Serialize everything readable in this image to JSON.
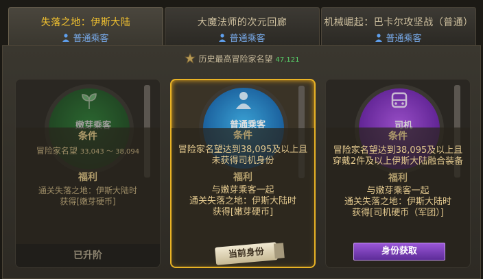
{
  "tabs": [
    {
      "title": "失落之地：伊斯大陆",
      "subtitle": "普通乘客"
    },
    {
      "title": "大魔法师的次元回廊",
      "subtitle": "普通乘客"
    },
    {
      "title": "机械崛起：巴卡尔攻坚战（普通）",
      "subtitle": "普通乘客"
    }
  ],
  "fame": {
    "label": "历史最高冒险家名望",
    "value": "47,121"
  },
  "cards": [
    {
      "emblem": "嫩芽乘客",
      "cond_title": "条件",
      "cond_line1": "冒险家名望",
      "cond_num": "33,043 ～ 38,094",
      "benefit_title": "福利",
      "benefit_line1": "通关失落之地：伊斯大陆时",
      "benefit_line2": "获得[嫩芽硬币]",
      "footer": "已升阶"
    },
    {
      "emblem": "普通乘客",
      "cond_title": "条件",
      "cond_line1": "冒险家名望达到38,095及以上且",
      "cond_line2": "未获得司机身份",
      "benefit_title": "福利",
      "benefit_line1": "与嫩芽乘客一起",
      "benefit_line2": "通关失落之地：伊斯大陆时",
      "benefit_line3": "获得[嫩芽硬币]",
      "footer": "当前身份"
    },
    {
      "emblem": "司机",
      "cond_title": "条件",
      "cond_line1": "冒险家名望达到38,095及以上且",
      "cond_line2": "穿戴2件及以上伊斯大陆融合装备",
      "benefit_title": "福利",
      "benefit_line1": "与嫩芽乘客一起",
      "benefit_line2": "通关失落之地：伊斯大陆时",
      "benefit_line3": "获得[司机硬币（军团）]",
      "footer": "身份获取"
    }
  ],
  "colors": {
    "active_tab_text": "#f2c230",
    "accent_gold": "#e9b325",
    "fame_value": "#59d36a",
    "button_purple": "#7a3fc0"
  },
  "icons": [
    "person-icon",
    "fame-medal-icon",
    "sprout-icon",
    "passenger-icon",
    "bus-icon"
  ]
}
